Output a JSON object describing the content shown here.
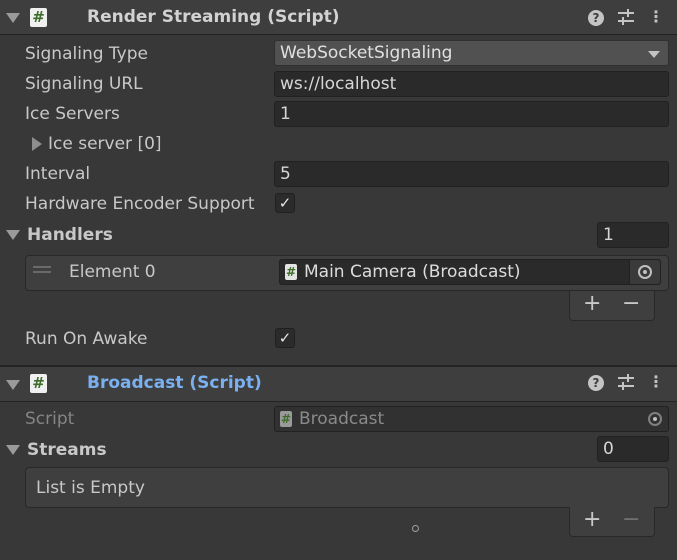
{
  "render_streaming": {
    "title": "Render Streaming (Script)",
    "icon": "#",
    "fields": {
      "signaling_type": {
        "label": "Signaling Type",
        "value": "WebSocketSignaling"
      },
      "signaling_url": {
        "label": "Signaling URL",
        "value": "ws://localhost"
      },
      "ice_servers": {
        "label": "Ice Servers",
        "value": "1"
      },
      "ice_server_item": {
        "label": "Ice server [0]"
      },
      "interval": {
        "label": "Interval",
        "value": "5"
      },
      "hw_encoder": {
        "label": "Hardware Encoder Support",
        "checked": true
      }
    },
    "handlers": {
      "label": "Handlers",
      "count": "1",
      "elements": [
        {
          "label": "Element 0",
          "value": "Main Camera (Broadcast)"
        }
      ]
    },
    "run_on_awake": {
      "label": "Run On Awake",
      "checked": true
    }
  },
  "broadcast": {
    "title": "Broadcast (Script)",
    "icon": "#",
    "script": {
      "label": "Script",
      "value": "Broadcast"
    },
    "streams": {
      "label": "Streams",
      "count": "0",
      "empty_text": "List is Empty"
    }
  },
  "glyphs": {
    "check": "✓",
    "plus": "+",
    "minus": "−",
    "help": "?",
    "hash": "#",
    "more": "⋮",
    "drag": "="
  },
  "colors": {
    "header_bg": "#3e3e3e",
    "panel_bg": "#383838",
    "field_bg": "#2a2a2a",
    "link_blue": "#7ab0f0"
  }
}
